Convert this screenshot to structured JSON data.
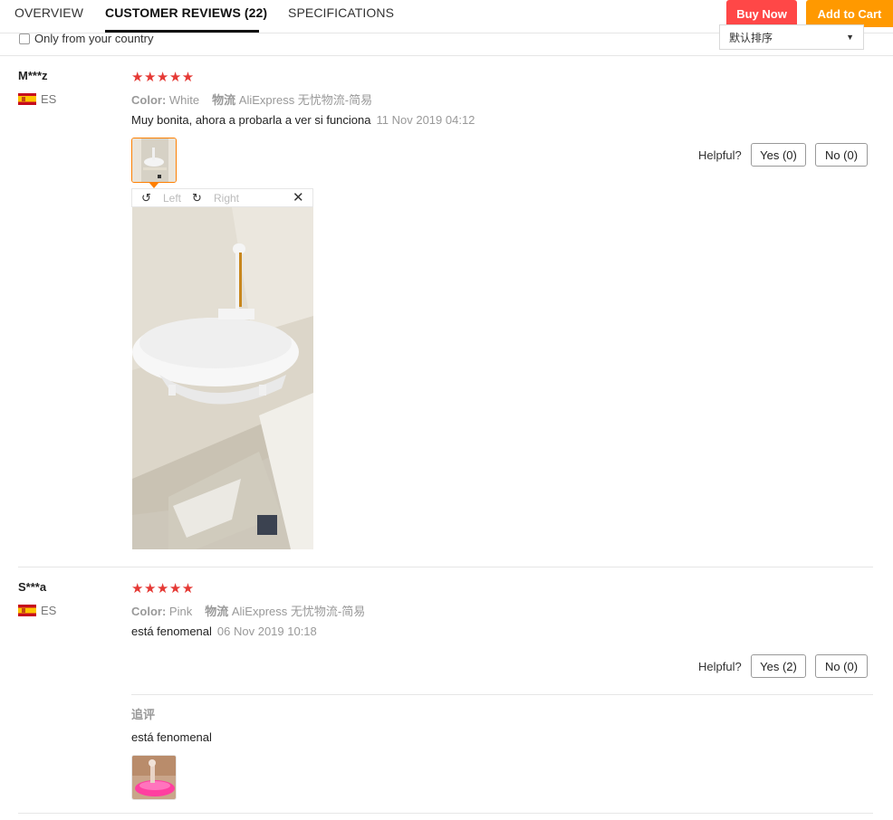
{
  "tabs": [
    {
      "label": "OVERVIEW"
    },
    {
      "label": "CUSTOMER REVIEWS (22)"
    },
    {
      "label": "SPECIFICATIONS"
    }
  ],
  "actions": {
    "buy_now": "Buy Now",
    "add_to_cart": "Add to Cart"
  },
  "filter": {
    "only_country_label": "Only from your country",
    "sort_selected": "默认排序"
  },
  "colors": {
    "buy_now": "#ff4747",
    "add_to_cart": "#ff9900",
    "stars": "#e53935",
    "thumb_border": "#ff7f00"
  },
  "reviews": [
    {
      "name": "M***z",
      "country": "ES",
      "rating_stars": "★★★★★",
      "color_label": "Color:",
      "color_value": "White",
      "shipping_label": "物流",
      "shipping_value": "AliExpress 无忧物流-简易",
      "text": "Muy bonita, ahora a probarla a ver si funciona",
      "date": "11 Nov 2019 04:12",
      "helpful_label": "Helpful?",
      "yes": "Yes (0)",
      "no": "No (0)",
      "viewer": {
        "left": "Left",
        "right": "Right",
        "close": "✕",
        "rotate_left_icon": "↺",
        "rotate_right_icon": "↻"
      }
    },
    {
      "name": "S***a",
      "country": "ES",
      "rating_stars": "★★★★★",
      "color_label": "Color:",
      "color_value": "Pink",
      "shipping_label": "物流",
      "shipping_value": "AliExpress 无忧物流-简易",
      "text": "está fenomenal",
      "date": "06 Nov 2019 10:18",
      "helpful_label": "Helpful?",
      "yes": "Yes (2)",
      "no": "No (0)",
      "followup_label": "追评",
      "followup_text": "está fenomenal"
    }
  ]
}
